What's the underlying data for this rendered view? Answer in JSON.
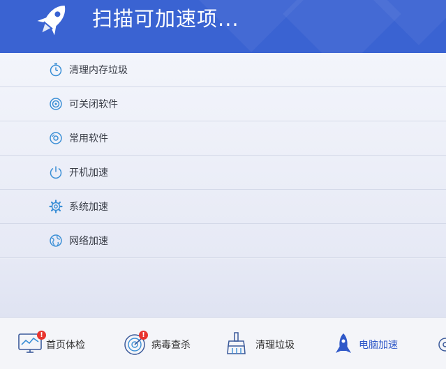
{
  "header": {
    "title": "扫描可加速项..."
  },
  "items": [
    {
      "label": "清理内存垃圾",
      "icon": "stopwatch-icon"
    },
    {
      "label": "可关闭软件",
      "icon": "target-icon"
    },
    {
      "label": "常用软件",
      "icon": "disc-icon"
    },
    {
      "label": "开机加速",
      "icon": "power-icon"
    },
    {
      "label": "系统加速",
      "icon": "gear-icon"
    },
    {
      "label": "网络加速",
      "icon": "globe-icon"
    }
  ],
  "nav": [
    {
      "label": "首页体检",
      "icon": "monitor-icon",
      "badge": "!"
    },
    {
      "label": "病毒查杀",
      "icon": "radar-icon",
      "badge": "!"
    },
    {
      "label": "清理垃圾",
      "icon": "broom-icon"
    },
    {
      "label": "电脑加速",
      "icon": "rocket-icon",
      "active": true
    }
  ],
  "colors": {
    "header": "#3a63d2",
    "accent": "#2f58c8",
    "icon": "#3b8fd6",
    "badge": "#e8342e"
  }
}
